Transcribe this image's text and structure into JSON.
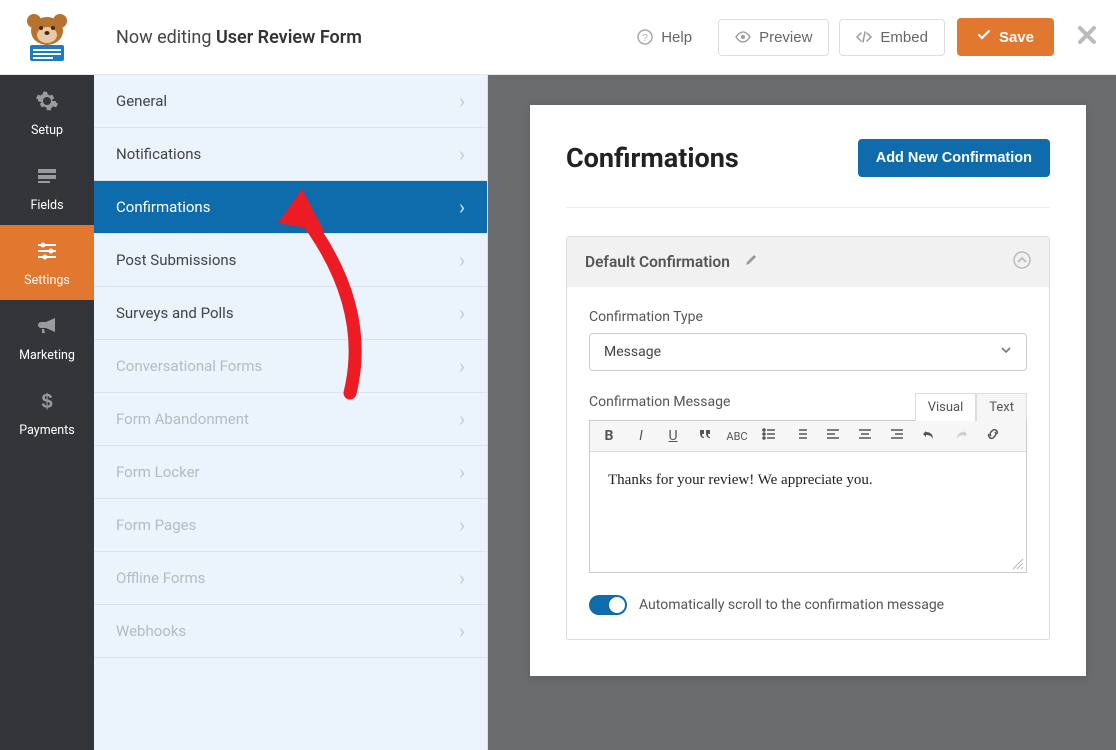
{
  "header": {
    "editing_prefix": "Now editing ",
    "form_name": "User Review Form",
    "help": "Help",
    "preview": "Preview",
    "embed": "Embed",
    "save": "Save"
  },
  "nav": {
    "setup": "Setup",
    "fields": "Fields",
    "settings": "Settings",
    "marketing": "Marketing",
    "payments": "Payments"
  },
  "sidebar": {
    "items": [
      {
        "label": "General",
        "state": "normal"
      },
      {
        "label": "Notifications",
        "state": "normal"
      },
      {
        "label": "Confirmations",
        "state": "active"
      },
      {
        "label": "Post Submissions",
        "state": "normal"
      },
      {
        "label": "Surveys and Polls",
        "state": "normal"
      },
      {
        "label": "Conversational Forms",
        "state": "disabled"
      },
      {
        "label": "Form Abandonment",
        "state": "disabled"
      },
      {
        "label": "Form Locker",
        "state": "disabled"
      },
      {
        "label": "Form Pages",
        "state": "disabled"
      },
      {
        "label": "Offline Forms",
        "state": "disabled"
      },
      {
        "label": "Webhooks",
        "state": "disabled"
      }
    ]
  },
  "panel": {
    "title": "Confirmations",
    "add_button": "Add New Confirmation",
    "card_title": "Default Confirmation",
    "field_type_label": "Confirmation Type",
    "field_type_value": "Message",
    "message_label": "Confirmation Message",
    "visual_tab": "Visual",
    "text_tab": "Text",
    "message_body": "Thanks for your review! We appreciate you.",
    "scroll_toggle_label": "Automatically scroll to the confirmation message"
  }
}
